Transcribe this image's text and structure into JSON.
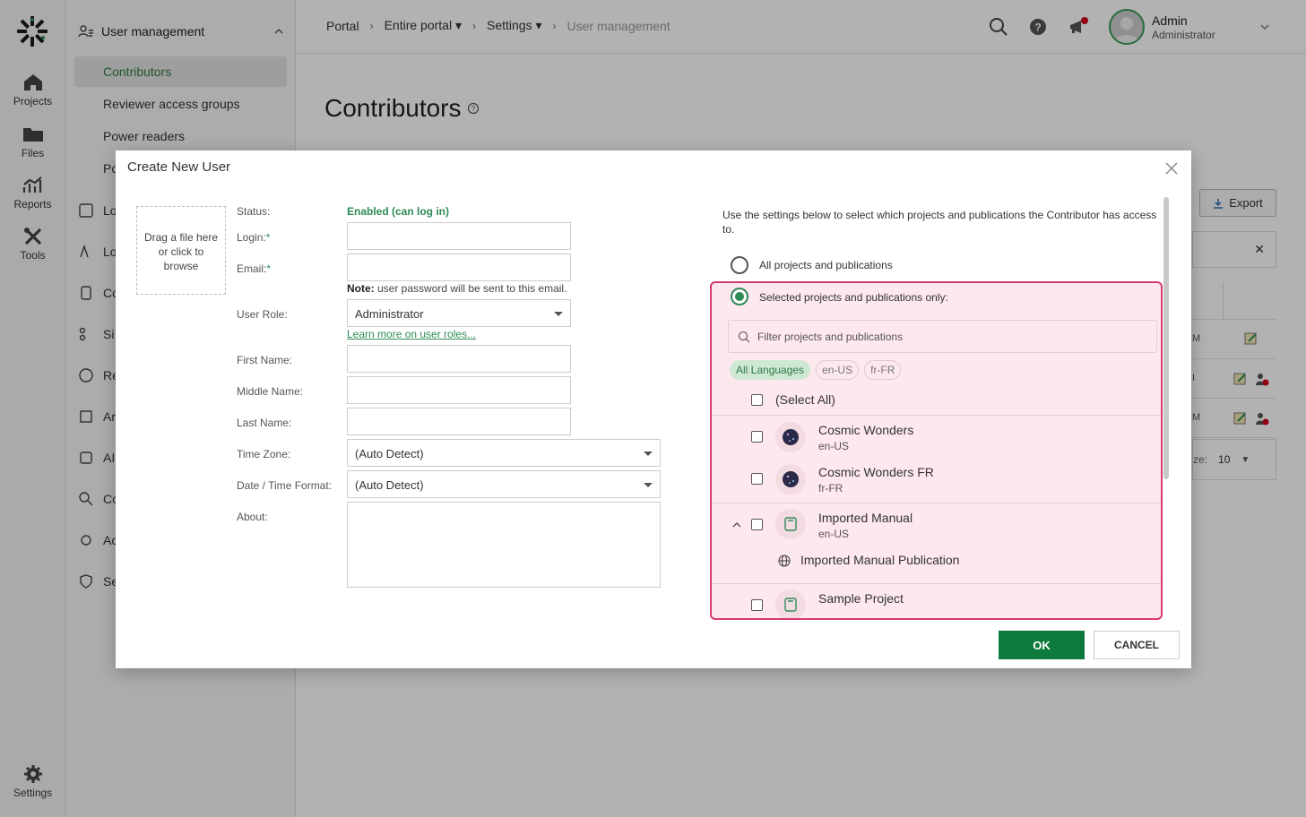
{
  "rail": {
    "items": [
      {
        "label": "Projects",
        "icon": "home-icon"
      },
      {
        "label": "Files",
        "icon": "folder-icon"
      },
      {
        "label": "Reports",
        "icon": "chart-icon"
      },
      {
        "label": "Tools",
        "icon": "tools-icon"
      },
      {
        "label": "Settings",
        "icon": "gear-icon"
      }
    ]
  },
  "sidebar": {
    "header": "User management",
    "items": [
      "Contributors",
      "Reviewer access groups",
      "Power readers",
      "Po"
    ],
    "sections": [
      "Lo",
      "Lo",
      "Co",
      "Si",
      "Re",
      "Ar",
      "AI",
      "Co",
      "Ac",
      "Se"
    ]
  },
  "breadcrumb": {
    "items": [
      "Portal",
      "Entire portal",
      "Settings",
      "User management"
    ]
  },
  "user": {
    "name": "Admin",
    "role": "Administrator"
  },
  "page": {
    "title": "Contributors",
    "export_label": "Export",
    "pager_label": "ze:",
    "pager_value": "10",
    "row_fragments": [
      "M",
      "I",
      "M"
    ]
  },
  "modal": {
    "title": "Create New User",
    "drop_zone": [
      "Drag a file here",
      "or click to",
      "browse"
    ],
    "fields": {
      "status_label": "Status:",
      "status_value": "Enabled (can log in)",
      "login_label": "Login:",
      "email_label": "Email:",
      "note_bold": "Note:",
      "note_text": " user password will be sent to this email.",
      "role_label": "User Role:",
      "role_value": "Administrator",
      "learn_more": "Learn more on user roles...",
      "first_label": "First Name:",
      "middle_label": "Middle Name:",
      "last_label": "Last Name:",
      "timezone_label": "Time Zone:",
      "timezone_value": "(Auto Detect)",
      "datetime_label": "Date / Time Format:",
      "datetime_value": "(Auto Detect)",
      "about_label": "About:",
      "required_mark": "*"
    },
    "access": {
      "intro": "Use the settings below to select which projects and publications the Contributor has access to.",
      "option_all": "All projects and publications",
      "option_selected": "Selected projects and publications only:",
      "filter_placeholder": "Filter projects and publications",
      "languages": [
        "All Languages",
        "en-US",
        "fr-FR"
      ],
      "select_all": "(Select All)",
      "projects": [
        {
          "name": "Cosmic Wonders",
          "lang": "en-US"
        },
        {
          "name": "Cosmic Wonders FR",
          "lang": "fr-FR"
        },
        {
          "name": "Imported Manual",
          "lang": "en-US"
        },
        {
          "name": "Sample Project",
          "lang": ""
        }
      ],
      "publication": "Imported Manual Publication"
    },
    "ok_label": "OK",
    "cancel_label": "CANCEL"
  }
}
